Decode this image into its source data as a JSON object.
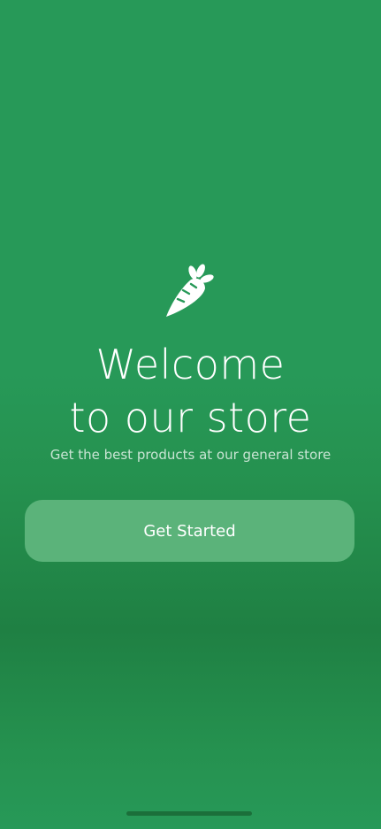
{
  "welcome": {
    "title_line1": "Welcome",
    "title_line2": "to our store",
    "subtitle": "Get the best products at our general store",
    "cta_label": "Get Started",
    "logo_icon": "carrot-icon"
  },
  "colors": {
    "background": "#279958",
    "button": "#5bb37a",
    "text": "#ffffff"
  }
}
